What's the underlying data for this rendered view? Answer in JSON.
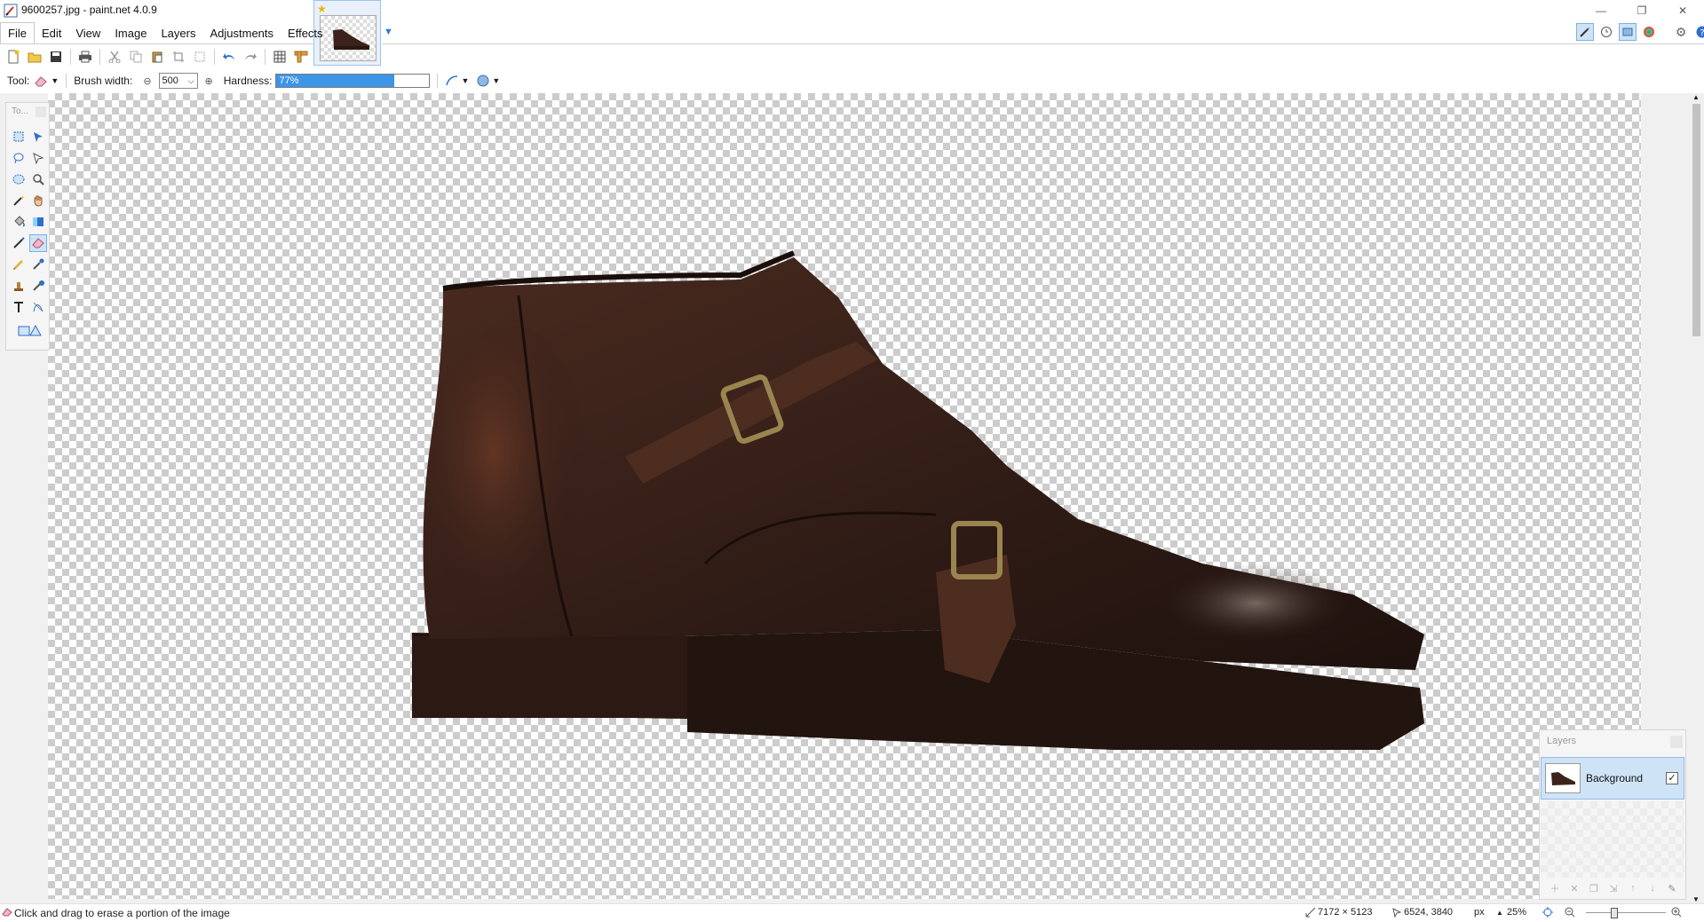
{
  "window": {
    "title": "9600257.jpg - paint.net 4.0.9",
    "minimize": "—",
    "restore": "❐",
    "close": "✕"
  },
  "menu": {
    "items": [
      "File",
      "Edit",
      "View",
      "Image",
      "Layers",
      "Adjustments",
      "Effects"
    ]
  },
  "tool_options": {
    "tool_label": "Tool:",
    "brush_width_label": "Brush width:",
    "brush_width_value": "500",
    "hardness_label": "Hardness:",
    "hardness_value": "77%",
    "hardness_fraction": 0.77
  },
  "tools_window": {
    "title": "To..."
  },
  "layers_window": {
    "title": "Layers",
    "layer_name": "Background",
    "layer_visible_mark": "✓"
  },
  "status": {
    "message": "Click and drag to erase a portion of the image",
    "image_size": "7172 × 5123",
    "cursor_position": "6524, 3840",
    "units": "px",
    "zoom": "25%"
  },
  "colors": {
    "accent": "#3d95e8",
    "selection": "#cfe3f7",
    "shoe_leather": "#3b231b"
  }
}
